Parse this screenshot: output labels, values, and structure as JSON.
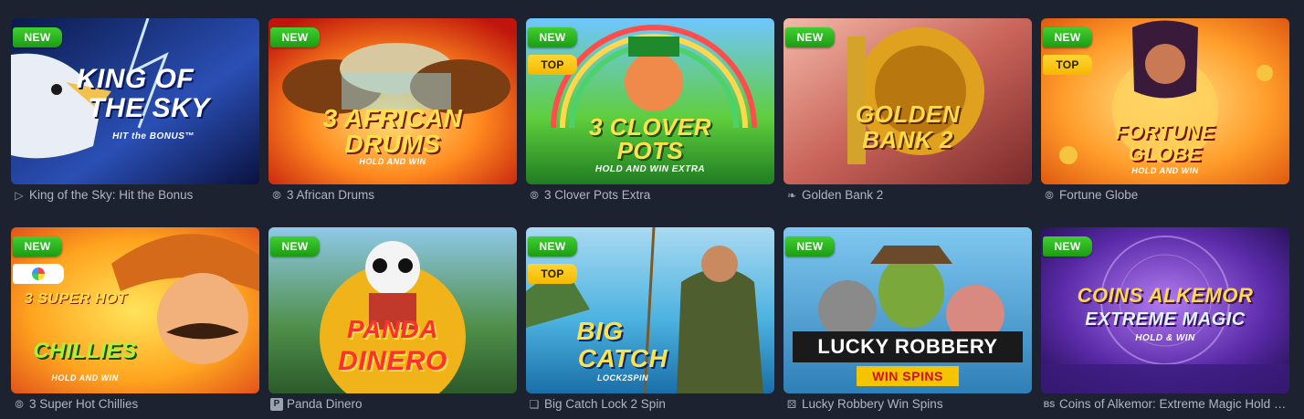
{
  "badges": {
    "new": "NEW",
    "top": "TOP"
  },
  "games": [
    {
      "title": "King of the Sky: Hit the Bonus",
      "logo_lines": [
        "KING OF",
        "THE SKY"
      ],
      "tagline": "HIT the BONUS™",
      "badges": [
        "NEW"
      ],
      "provider_icon": "play-triangle-icon"
    },
    {
      "title": "3 African Drums",
      "logo_lines": [
        "3 AFRICAN",
        "DRUMS"
      ],
      "tagline": "HOLD AND WIN",
      "badges": [
        "NEW"
      ],
      "provider_icon": "spiral-icon"
    },
    {
      "title": "3 Clover Pots Extra",
      "logo_lines": [
        "3 CLOVER",
        "POTS"
      ],
      "tagline": "HOLD AND WIN EXTRA",
      "badges": [
        "NEW",
        "TOP"
      ],
      "provider_icon": "spiral-icon"
    },
    {
      "title": "Golden Bank 2",
      "logo_lines": [
        "GOLDEN",
        "BANK 2"
      ],
      "tagline": "",
      "badges": [
        "NEW"
      ],
      "provider_icon": "claw-icon"
    },
    {
      "title": "Fortune Globe",
      "logo_lines": [
        "FORTUNE",
        "GLOBE"
      ],
      "tagline": "HOLD AND WIN",
      "badges": [
        "NEW",
        "TOP"
      ],
      "provider_icon": "spiral-icon"
    },
    {
      "title": "3 Super Hot Chillies",
      "logo_lines": [
        "3 SUPER HOT",
        "CHILLIES"
      ],
      "tagline": "HOLD AND WIN",
      "badges": [
        "NEW"
      ],
      "provider_icon": "spiral-icon"
    },
    {
      "title": "Panda Dinero",
      "logo_lines": [
        "PANDA",
        "DINERO"
      ],
      "tagline": "",
      "badges": [
        "NEW"
      ],
      "provider_icon": "p-square-icon"
    },
    {
      "title": "Big Catch Lock 2 Spin",
      "logo_lines": [
        "BIG",
        "CATCH"
      ],
      "tagline": "LOCK2SPIN",
      "badges": [
        "NEW",
        "TOP"
      ],
      "provider_icon": "cube-icon"
    },
    {
      "title": "Lucky Robbery Win Spins",
      "logo_lines": [
        "LUCKY ROBBERY"
      ],
      "tagline": "WIN SPINS",
      "badges": [
        "NEW"
      ],
      "provider_icon": "dice-icon"
    },
    {
      "title": "Coins of Alkemor: Extreme Magic Hold & Win",
      "logo_lines": [
        "COINS ALKEMOR",
        "EXTREME MAGIC"
      ],
      "tagline": "HOLD & WIN",
      "badges": [
        "NEW"
      ],
      "provider_icon": "bs-icon"
    }
  ],
  "colors": {
    "background": "#1c2230",
    "badge_new": "#2bb51f",
    "badge_top": "#f7c400",
    "title_text": "#aeb6c4"
  }
}
